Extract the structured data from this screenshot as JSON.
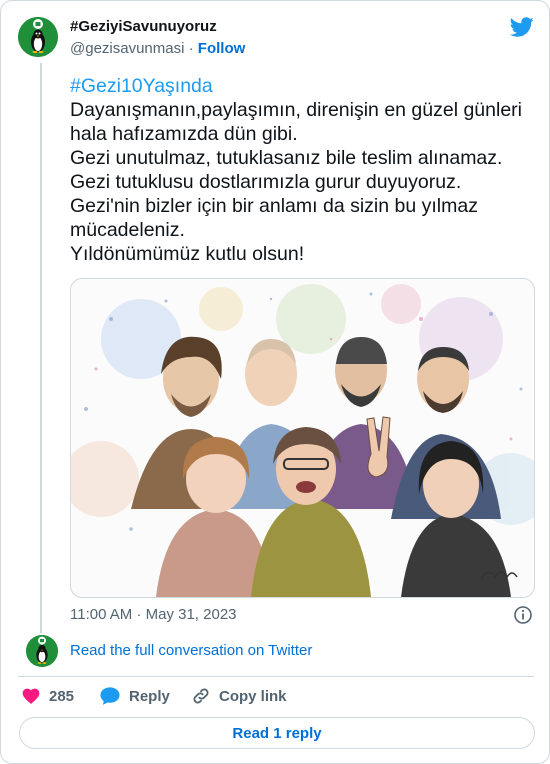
{
  "author": {
    "name": "#GeziyiSavunuyoruz",
    "handle": "@gezisavunmasi",
    "separator": "·",
    "follow_label": "Follow"
  },
  "tweet": {
    "hashtag": "#Gezi10Yaşında",
    "lines": [
      "Dayanışmanın,paylaşımın, direnişin en güzel günleri",
      "hala hafızamızda dün gibi.",
      "Gezi unutulmaz, tutuklasanız bile teslim alınamaz.",
      "Gezi tutuklusu dostlarımızla gurur duyuyoruz.",
      "Gezi'nin bizler için bir anlamı da sizin bu yılmaz",
      "mücadeleniz.",
      "Yıldönümümüz kutlu olsun!"
    ],
    "time": "11:00 AM",
    "date": "May 31, 2023",
    "meta_separator": "·"
  },
  "thread": {
    "read_conversation": "Read the full conversation on Twitter"
  },
  "actions": {
    "like_count": "285",
    "reply_label": "Reply",
    "copy_link_label": "Copy link",
    "read_reply_label": "Read 1 reply"
  },
  "colors": {
    "brand_blue": "#1d9bf0",
    "link_blue": "#006fd6",
    "like_pink": "#f91880",
    "avatar_green": "#1f8f3a",
    "muted_text": "#536471",
    "border": "#cfd9de"
  },
  "icons": {
    "brand": "twitter-bird-icon",
    "avatar": "penguin-logo-icon",
    "info": "info-icon",
    "like": "heart-icon",
    "reply": "speech-bubble-icon",
    "copy": "link-icon"
  }
}
